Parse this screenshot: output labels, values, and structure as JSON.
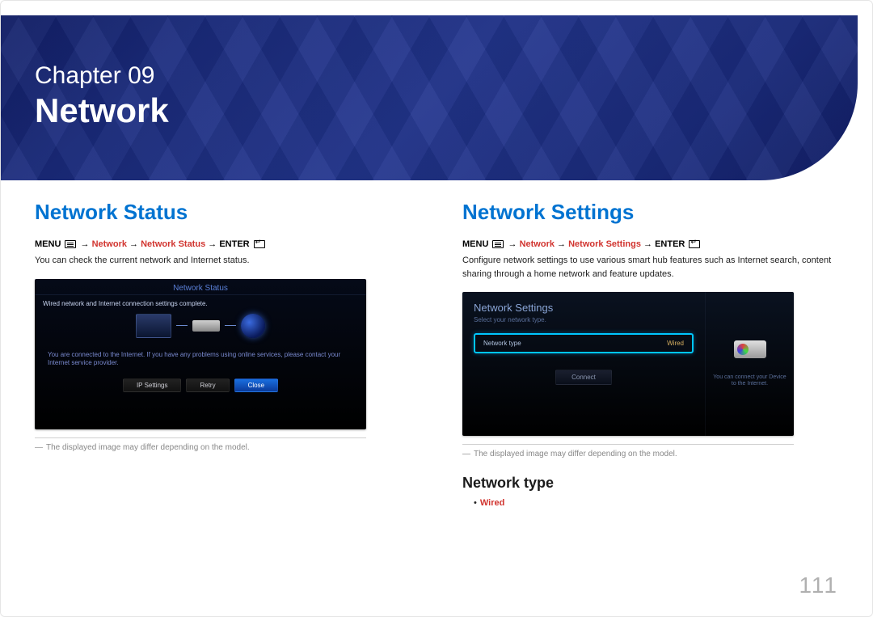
{
  "chapter": {
    "label": "Chapter  09",
    "title": "Network"
  },
  "left": {
    "heading": "Network Status",
    "nav": {
      "menu": "MENU",
      "sep": " → ",
      "p1": "Network",
      "p2": "Network Status",
      "enter": "ENTER"
    },
    "body": "You can check the current network and Internet status.",
    "ss": {
      "title": "Network Status",
      "msg": "Wired network and Internet connection settings complete.",
      "info": "You are connected to the Internet. If you have any problems using online services, please contact your Internet service provider.",
      "btn1": "IP Settings",
      "btn2": "Retry",
      "btn3": "Close"
    },
    "footnote": "The displayed image may differ depending on the model."
  },
  "right": {
    "heading": "Network Settings",
    "nav": {
      "menu": "MENU",
      "sep": " → ",
      "p1": "Network",
      "p2": "Network Settings",
      "enter": "ENTER"
    },
    "body": "Configure network settings to use various smart hub features such as Internet search, content sharing through a home network and feature updates.",
    "ss": {
      "title": "Network Settings",
      "sub": "Select your network type.",
      "field_label": "Network type",
      "field_value": "Wired",
      "connect": "Connect",
      "hint": "You can connect your Device to the Internet."
    },
    "footnote": "The displayed image may differ depending on the model.",
    "subsection": "Network type",
    "bullet": "Wired"
  },
  "page_number": "111",
  "dash": "―"
}
